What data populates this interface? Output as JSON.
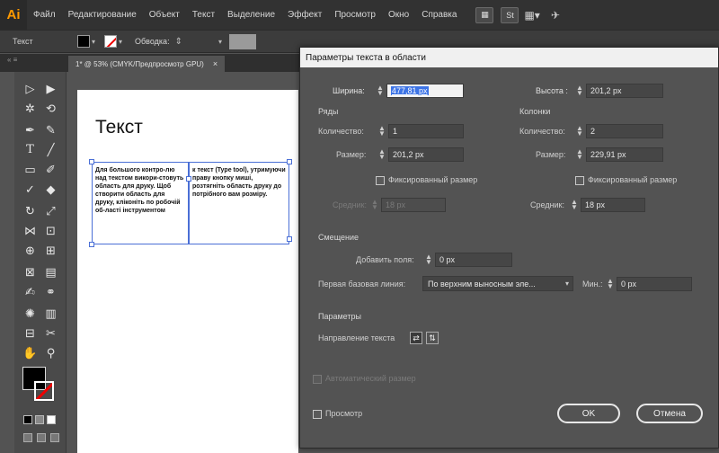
{
  "menubar": {
    "app_logo": "Ai",
    "items": [
      "Файл",
      "Редактирование",
      "Объект",
      "Текст",
      "Выделение",
      "Эффект",
      "Просмотр",
      "Окно",
      "Справка"
    ],
    "st_badge": "St"
  },
  "controlbar": {
    "tool_label": "Текст",
    "stroke_label": "Обводка:"
  },
  "document": {
    "tab_title": "1* @ 53% (CMYK/Предпросмотр GPU)",
    "tab_close": "×"
  },
  "artboard": {
    "heading": "Текст",
    "column1_text": "Для большого контро-лю над текстом викори-стовуть область для друку. Щоб створити область для друку, кліконіть по робочій об-ласті інструментом",
    "column2_text": "к текст (Type tool), утримуючи праву кнопку миші, розтягніть область друку до потрібного вам розміру."
  },
  "dialog": {
    "title": "Параметры текста в области",
    "width_label": "Ширина:",
    "width_value": "477,81 px",
    "height_label": "Высота :",
    "height_value": "201,2 px",
    "rows": {
      "heading": "Ряды",
      "count_label": "Количество:",
      "count_value": "1",
      "size_label": "Размер:",
      "size_value": "201,2 px",
      "fixed_label": "Фиксированный размер",
      "gutter_label": "Средник:",
      "gutter_value": "18 px"
    },
    "columns": {
      "heading": "Колонки",
      "count_label": "Количество:",
      "count_value": "2",
      "size_label": "Размер:",
      "size_value": "229,91 px",
      "fixed_label": "Фиксированный размер",
      "gutter_label": "Средник:",
      "gutter_value": "18 px"
    },
    "offset": {
      "heading": "Смещение",
      "inset_label": "Добавить поля:",
      "inset_value": "0 px",
      "baseline_label": "Первая базовая линия:",
      "baseline_value": "По верхним выносным эле...",
      "min_label": "Мин.:",
      "min_value": "0 px"
    },
    "options": {
      "heading": "Параметры",
      "flow_label": "Направление текста"
    },
    "auto_size_label": "Автоматический размер",
    "preview_label": "Просмотр",
    "ok_label": "OK",
    "cancel_label": "Отмена"
  }
}
